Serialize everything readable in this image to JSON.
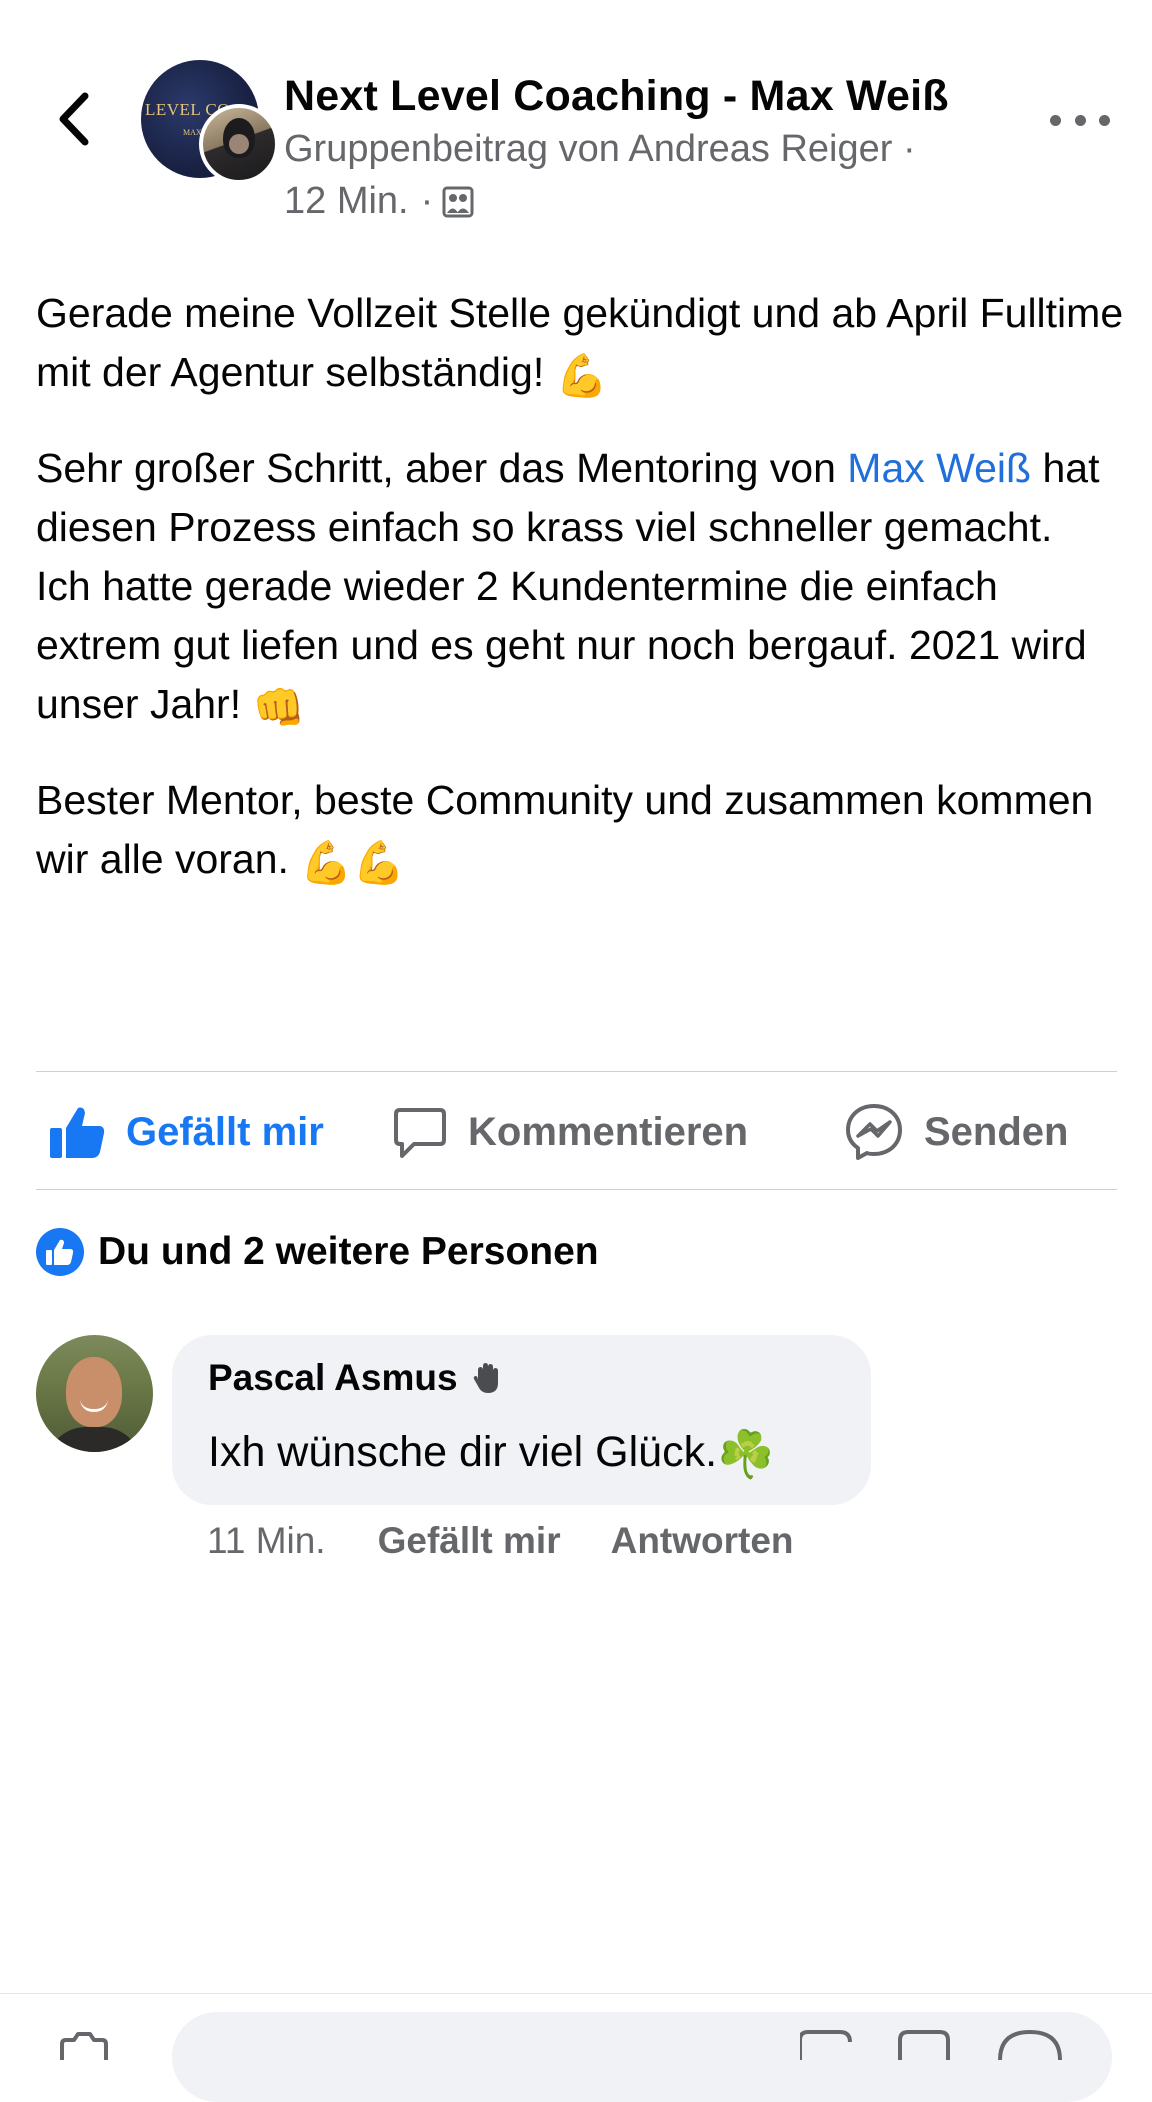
{
  "header": {
    "title": "Next Level Coaching - Max Weiß",
    "subtitle": "Gruppenbeitrag von Andreas Reiger ·",
    "time": "12 Min.",
    "separator": "·",
    "group_avatar_text": "LEVEL CO",
    "group_avatar_subtext": "MAX"
  },
  "post": {
    "p1_line": "Gerade meine Vollzeit Stelle gekündigt und ab April Fulltime mit der Agentur selbständig!",
    "p2_before": "Sehr großer Schritt, aber das Mentoring von",
    "p2_mention": "Max Weiß",
    "p2_after": "hat diesen Prozess einfach so krass viel schneller gemacht.",
    "p3": "Ich hatte gerade wieder 2 Kundentermine die einfach extrem gut liefen und es geht nur noch bergauf. 2021 wird unser Jahr!",
    "p4": "Bester Mentor, beste Community und zusammen kommen wir alle voran."
  },
  "emoji": {
    "muscle": "💪",
    "fist": "👊",
    "clover": "☘️"
  },
  "actions": {
    "like": "Gefällt mir",
    "comment": "Kommentieren",
    "send": "Senden"
  },
  "reactions": {
    "label": "Du und 2 weitere Personen"
  },
  "comment": {
    "author": "Pascal Asmus",
    "text": "Ixh wünsche dir viel Glück.",
    "time": "11 Min.",
    "like": "Gefällt mir",
    "reply": "Antworten"
  },
  "colors": {
    "facebook_blue": "#1877f2",
    "mention_blue": "#216fdb",
    "secondary_text": "#65676b",
    "bubble_bg": "#f0f2f5"
  },
  "icons": {
    "back": "chevron-left-icon",
    "more": "more-horizontal-icon",
    "audience": "group-audience-icon",
    "like": "thumbs-up-icon",
    "comment": "comment-icon",
    "send": "messenger-icon",
    "badge": "wave-badge-icon"
  }
}
